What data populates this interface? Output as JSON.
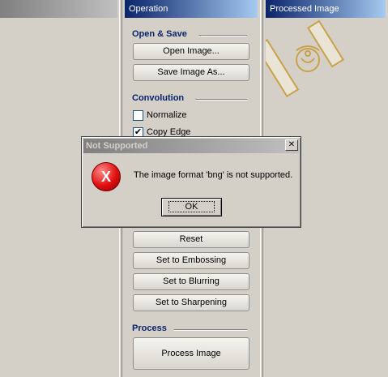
{
  "panels": {
    "left_title": "",
    "operation_title": "Operation",
    "processed_title": "Processed Image"
  },
  "sections": {
    "open_save": "Open & Save",
    "convolution": "Convolution",
    "process": "Process"
  },
  "buttons": {
    "open_image": "Open Image...",
    "save_image_as": "Save Image As...",
    "reset": "Reset",
    "embossing": "Set to Embossing",
    "blurring": "Set to Blurring",
    "sharpening": "Set to Sharpening",
    "process_image": "Process Image"
  },
  "checkboxes": {
    "normalize": {
      "label": "Normalize",
      "checked": false
    },
    "copy_edge": {
      "label": "Copy Edge",
      "checked": true
    }
  },
  "dialog": {
    "title": "Not Supported",
    "close_glyph": "✕",
    "icon_glyph": "X",
    "message": "The image format 'bng' is not supported.",
    "ok_label": "OK"
  },
  "colors": {
    "title_active": "#0a246a",
    "title_inactive": "#808080",
    "error_red": "#e01010",
    "window_bg": "#d4d0c8",
    "image_gold": "#c9a24a"
  }
}
